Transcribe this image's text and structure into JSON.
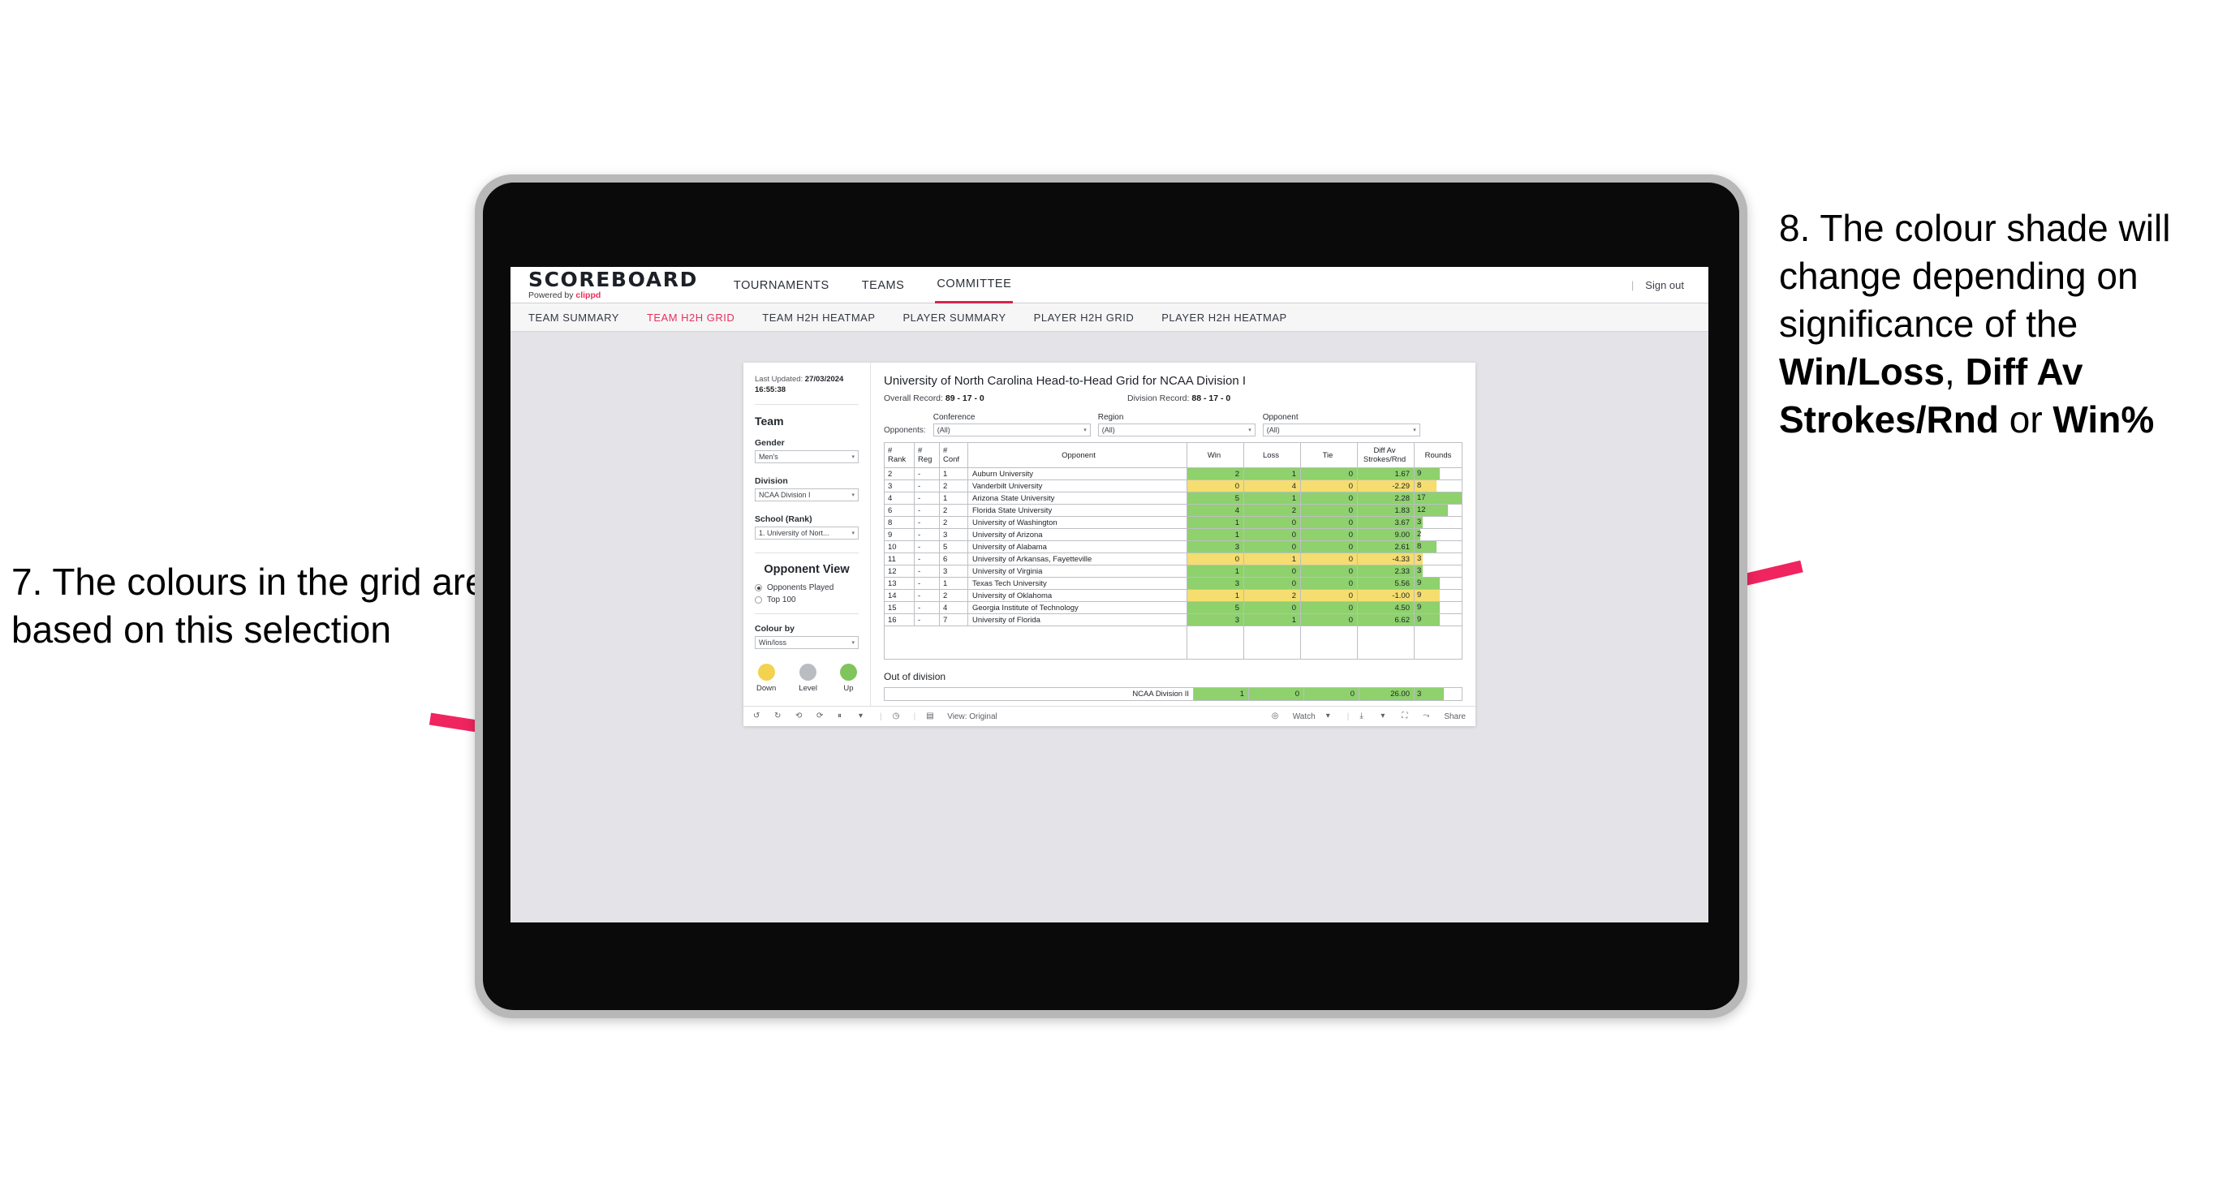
{
  "annotations": {
    "left": "7. The colours in the grid are based on this selection",
    "right_prefix": "8. The colour shade will change depending on significance of the ",
    "right_bold1": "Win/Loss",
    "right_mid1": ", ",
    "right_bold2": "Diff Av Strokes/Rnd",
    "right_mid2": " or ",
    "right_bold3": "Win%",
    "arrow_color": "#f0245f"
  },
  "header": {
    "brand_title": "SCOREBOARD",
    "brand_sub_prefix": "Powered by ",
    "brand_sub_accent": "clippd",
    "nav": [
      {
        "label": "TOURNAMENTS",
        "active": false
      },
      {
        "label": "TEAMS",
        "active": false
      },
      {
        "label": "COMMITTEE",
        "active": true
      }
    ],
    "divider": "|",
    "sign_out": "Sign out"
  },
  "subnav": [
    {
      "label": "TEAM SUMMARY",
      "active": false
    },
    {
      "label": "TEAM H2H GRID",
      "active": true
    },
    {
      "label": "TEAM H2H HEATMAP",
      "active": false
    },
    {
      "label": "PLAYER SUMMARY",
      "active": false
    },
    {
      "label": "PLAYER H2H GRID",
      "active": false
    },
    {
      "label": "PLAYER H2H HEATMAP",
      "active": false
    }
  ],
  "sidebar": {
    "last_updated_label": "Last Updated:",
    "last_updated_date": "27/03/2024",
    "last_updated_time": "16:55:38",
    "team_heading": "Team",
    "fields": [
      {
        "label": "Gender",
        "value": "Men's"
      },
      {
        "label": "Division",
        "value": "NCAA Division I"
      },
      {
        "label": "School (Rank)",
        "value": "1. University of Nort..."
      }
    ],
    "opponent_view_heading": "Opponent View",
    "radios": [
      {
        "label": "Opponents Played",
        "selected": true
      },
      {
        "label": "Top 100",
        "selected": false
      }
    ],
    "colour_by_label": "Colour by",
    "colour_by_value": "Win/loss",
    "legend": [
      {
        "label": "Down",
        "color": "#f2d24e"
      },
      {
        "label": "Level",
        "color": "#b9bcc1"
      },
      {
        "label": "Up",
        "color": "#80c45c"
      }
    ]
  },
  "main": {
    "title": "University of North Carolina Head-to-Head Grid for NCAA Division I",
    "overall_record_label": "Overall Record:",
    "overall_record_value": "89 - 17 - 0",
    "division_record_label": "Division Record:",
    "division_record_value": "88 - 17 - 0",
    "opponents_label": "Opponents:",
    "filters": [
      {
        "label": "Conference",
        "value": "(All)"
      },
      {
        "label": "Region",
        "value": "(All)"
      },
      {
        "label": "Opponent",
        "value": "(All)"
      }
    ],
    "columns": [
      "# Rank",
      "# Reg",
      "# Conf",
      "Opponent",
      "Win",
      "Loss",
      "Tie",
      "Diff Av Strokes/Rnd",
      "Rounds"
    ],
    "out_of_division_title": "Out of division",
    "out_of_division_row": {
      "label": "NCAA Division II",
      "win": "1",
      "loss": "0",
      "tie": "0",
      "diff": "26.00",
      "rounds": "3"
    }
  },
  "toolbar": {
    "view_label": "View: Original",
    "watch_label": "Watch",
    "share_label": "Share"
  },
  "colors": {
    "up": "#8ed16d",
    "down": "#f5dd6f",
    "accent": "#e8305a"
  },
  "chart_data": {
    "type": "table",
    "title": "University of North Carolina Head-to-Head Grid for NCAA Division I",
    "columns": [
      "#Rank",
      "#Reg",
      "#Conf",
      "Opponent",
      "Win",
      "Loss",
      "Tie",
      "Diff Av Strokes/Rnd",
      "Rounds"
    ],
    "rounds_max": 17,
    "rows": [
      {
        "rank": "2",
        "reg": "-",
        "conf": "1",
        "opponent": "Auburn University",
        "win": "2",
        "loss": "1",
        "tie": "0",
        "diff": "1.67",
        "rounds": "9",
        "state": "up"
      },
      {
        "rank": "3",
        "reg": "-",
        "conf": "2",
        "opponent": "Vanderbilt University",
        "win": "0",
        "loss": "4",
        "tie": "0",
        "diff": "-2.29",
        "rounds": "8",
        "state": "down"
      },
      {
        "rank": "4",
        "reg": "-",
        "conf": "1",
        "opponent": "Arizona State University",
        "win": "5",
        "loss": "1",
        "tie": "0",
        "diff": "2.28",
        "rounds": "17",
        "state": "up"
      },
      {
        "rank": "6",
        "reg": "-",
        "conf": "2",
        "opponent": "Florida State University",
        "win": "4",
        "loss": "2",
        "tie": "0",
        "diff": "1.83",
        "rounds": "12",
        "state": "up"
      },
      {
        "rank": "8",
        "reg": "-",
        "conf": "2",
        "opponent": "University of Washington",
        "win": "1",
        "loss": "0",
        "tie": "0",
        "diff": "3.67",
        "rounds": "3",
        "state": "up"
      },
      {
        "rank": "9",
        "reg": "-",
        "conf": "3",
        "opponent": "University of Arizona",
        "win": "1",
        "loss": "0",
        "tie": "0",
        "diff": "9.00",
        "rounds": "2",
        "state": "up"
      },
      {
        "rank": "10",
        "reg": "-",
        "conf": "5",
        "opponent": "University of Alabama",
        "win": "3",
        "loss": "0",
        "tie": "0",
        "diff": "2.61",
        "rounds": "8",
        "state": "up"
      },
      {
        "rank": "11",
        "reg": "-",
        "conf": "6",
        "opponent": "University of Arkansas, Fayetteville",
        "win": "0",
        "loss": "1",
        "tie": "0",
        "diff": "-4.33",
        "rounds": "3",
        "state": "down"
      },
      {
        "rank": "12",
        "reg": "-",
        "conf": "3",
        "opponent": "University of Virginia",
        "win": "1",
        "loss": "0",
        "tie": "0",
        "diff": "2.33",
        "rounds": "3",
        "state": "up"
      },
      {
        "rank": "13",
        "reg": "-",
        "conf": "1",
        "opponent": "Texas Tech University",
        "win": "3",
        "loss": "0",
        "tie": "0",
        "diff": "5.56",
        "rounds": "9",
        "state": "up"
      },
      {
        "rank": "14",
        "reg": "-",
        "conf": "2",
        "opponent": "University of Oklahoma",
        "win": "1",
        "loss": "2",
        "tie": "0",
        "diff": "-1.00",
        "rounds": "9",
        "state": "down"
      },
      {
        "rank": "15",
        "reg": "-",
        "conf": "4",
        "opponent": "Georgia Institute of Technology",
        "win": "5",
        "loss": "0",
        "tie": "0",
        "diff": "4.50",
        "rounds": "9",
        "state": "up"
      },
      {
        "rank": "16",
        "reg": "-",
        "conf": "7",
        "opponent": "University of Florida",
        "win": "3",
        "loss": "1",
        "tie": "0",
        "diff": "6.62",
        "rounds": "9",
        "state": "up"
      }
    ]
  }
}
